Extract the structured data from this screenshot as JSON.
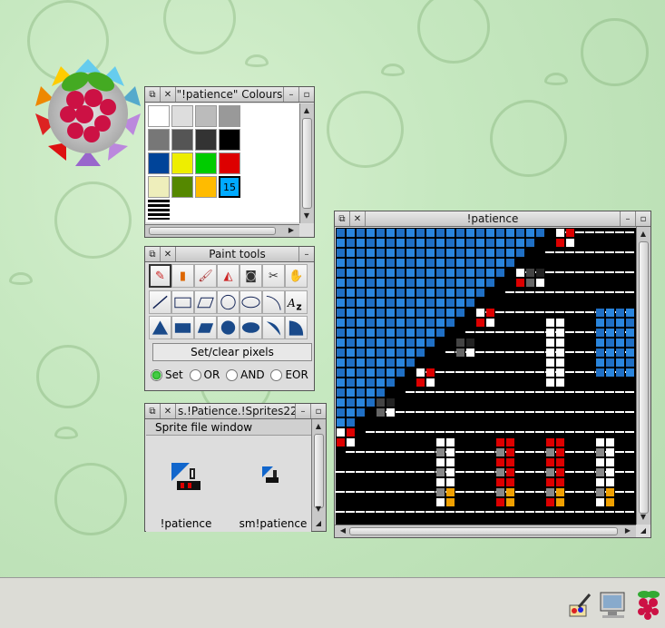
{
  "colours_window": {
    "title": "\"!patience\" Colours",
    "selected_index_label": "15"
  },
  "palette": [
    "#ffffff",
    "#dddddd",
    "#bbbbbb",
    "#999999",
    "#777777",
    "#555555",
    "#333333",
    "#000000",
    "#004499",
    "#eeee00",
    "#00cc00",
    "#dd0000",
    "#eeeebb",
    "#558800",
    "#ffbb00",
    "#00aaff"
  ],
  "paint_tools": {
    "title": "Paint tools",
    "top_icons": [
      "brush-icon",
      "spray-can-icon",
      "paintbrush-icon",
      "fill-icon",
      "camera-icon",
      "scissors-icon",
      "hand-icon"
    ],
    "shape_icons": [
      "line-icon",
      "rectangle-icon",
      "parallelogram-icon",
      "circle-icon",
      "ellipse-icon",
      "arc-icon",
      "text-icon",
      "filled-triangle-icon",
      "filled-rectangle-icon",
      "filled-parallelogram-icon",
      "filled-circle-icon",
      "filled-ellipse-icon",
      "filled-arc-icon",
      "filled-segment-icon"
    ],
    "mode_label": "Set/clear pixels",
    "radios": [
      "Set",
      "OR",
      "AND",
      "EOR"
    ]
  },
  "sprites_window": {
    "title": "s.!Patience.!Sprites22",
    "header": "Sprite file window",
    "sprites": [
      "!patience",
      "sm!patience"
    ]
  },
  "patience_window": {
    "title": "!patience"
  },
  "taskbar": {
    "icons": [
      "paint-app-icon",
      "display-icon",
      "raspberry-menu-icon"
    ]
  }
}
